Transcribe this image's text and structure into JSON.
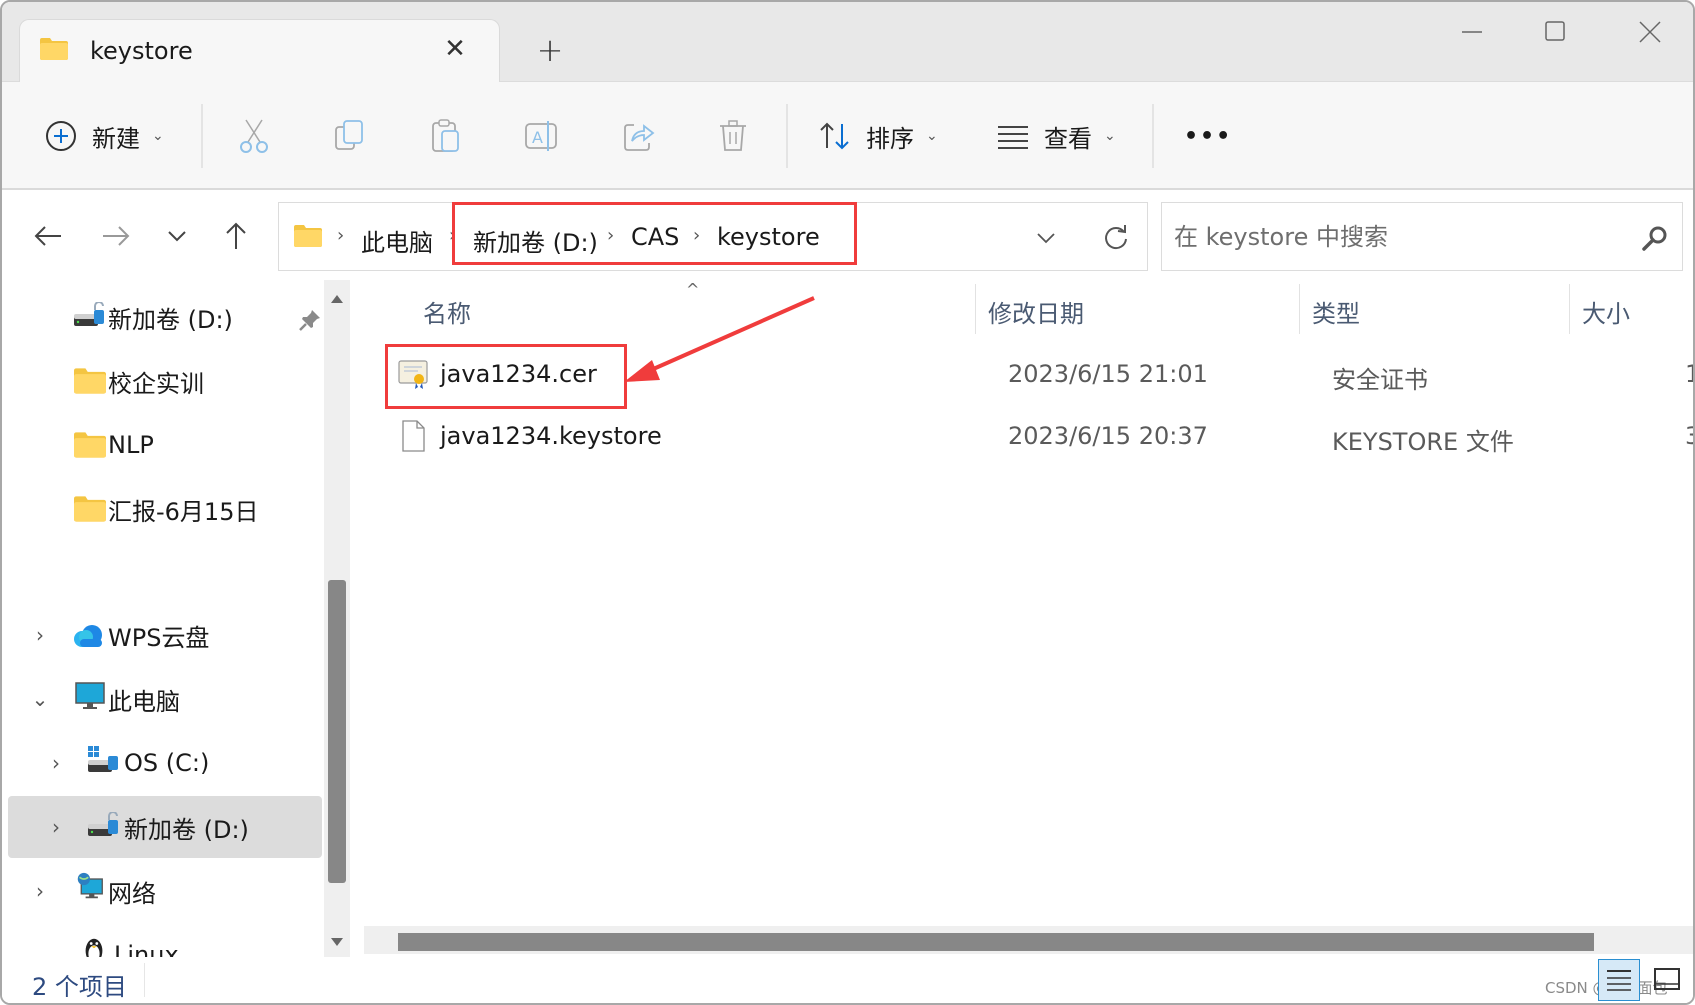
{
  "window": {
    "tab_title": "keystore",
    "new_tab_label": "+",
    "controls": [
      "minimize",
      "maximize",
      "close"
    ]
  },
  "toolbar": {
    "new_label": "新建",
    "sort_label": "排序",
    "view_label": "查看",
    "icons": [
      "cut-icon",
      "copy-icon",
      "paste-icon",
      "rename-icon",
      "share-icon",
      "delete-icon"
    ],
    "more_label": "•••"
  },
  "address": {
    "breadcrumb": [
      {
        "label": "此电脑"
      },
      {
        "label": "新加卷 (D:)"
      },
      {
        "label": "CAS"
      },
      {
        "label": "keystore"
      }
    ]
  },
  "search": {
    "placeholder": "在 keystore 中搜索",
    "value": ""
  },
  "sidebar": {
    "quick_access": [
      {
        "label": "新加卷 (D:)",
        "icon": "drive-icon",
        "pinned": true
      },
      {
        "label": "校企实训",
        "icon": "folder-icon"
      },
      {
        "label": "NLP",
        "icon": "folder-icon"
      },
      {
        "label": "汇报-6月15日",
        "icon": "folder-icon"
      }
    ],
    "tree": [
      {
        "label": "WPS云盘",
        "icon": "cloud-icon",
        "expanded": false
      },
      {
        "label": "此电脑",
        "icon": "computer-icon",
        "expanded": true
      },
      {
        "label": "OS (C:)",
        "icon": "system-drive-icon",
        "expanded": false
      },
      {
        "label": "新加卷 (D:)",
        "icon": "drive-icon",
        "expanded": false,
        "selected": true
      },
      {
        "label": "网络",
        "icon": "network-icon",
        "expanded": false
      },
      {
        "label": "Linux",
        "icon": "linux-icon",
        "expanded": true
      }
    ]
  },
  "columns": {
    "name": "名称",
    "modified": "修改日期",
    "type": "类型",
    "size": "大小"
  },
  "files": [
    {
      "name": "java1234.cer",
      "modified": "2023/6/15 21:01",
      "type": "安全证书",
      "size": "1",
      "icon": "certificate-icon",
      "highlighted": true
    },
    {
      "name": "java1234.keystore",
      "modified": "2023/6/15 20:37",
      "type": "KEYSTORE 文件",
      "size": "3",
      "icon": "file-icon"
    }
  ],
  "status": {
    "item_count": "2 个项目"
  },
  "annotation": {
    "color": "#f03c3c"
  },
  "watermark": "CSDN @盼盼面包"
}
